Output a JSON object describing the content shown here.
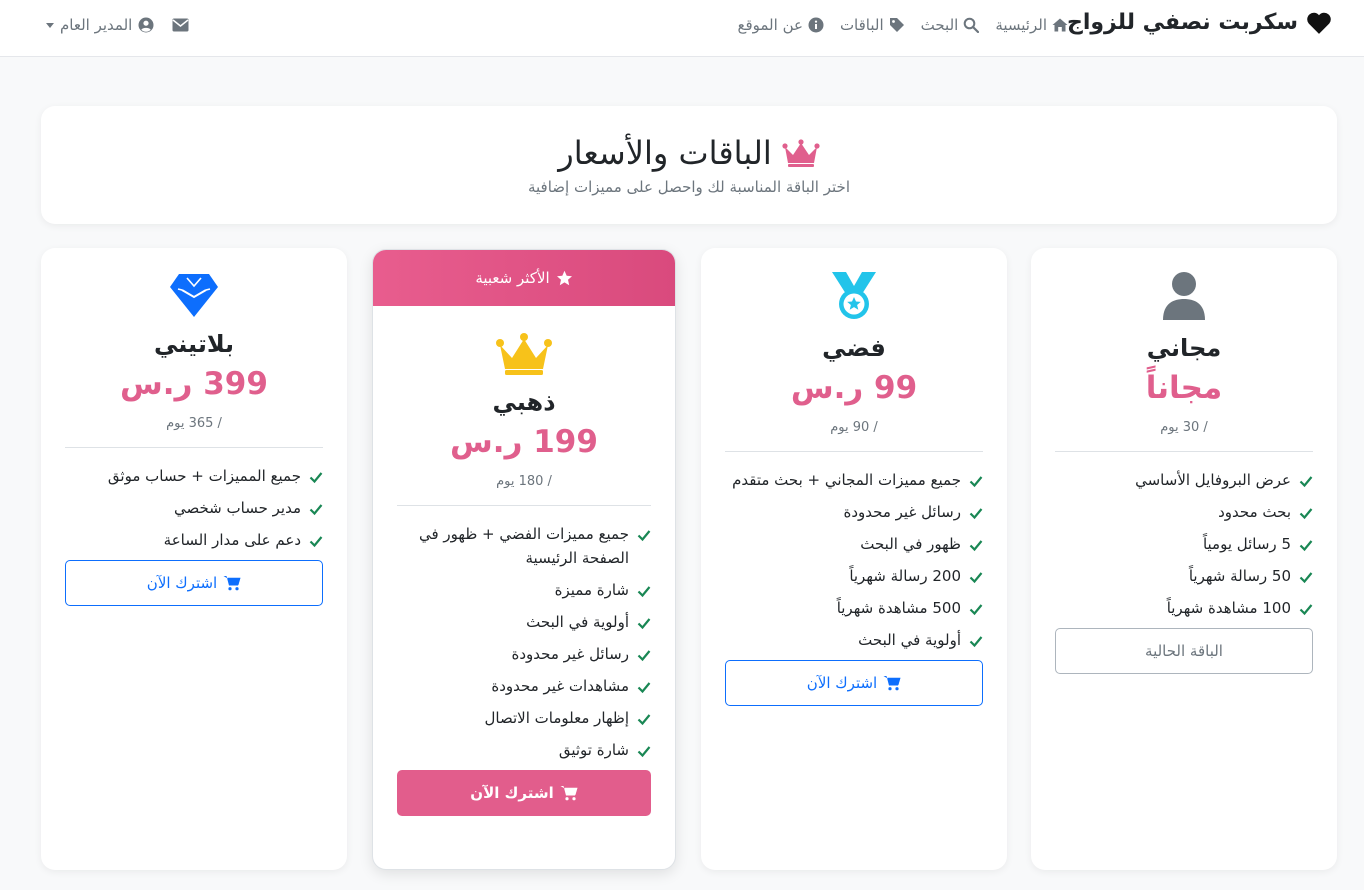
{
  "navbar": {
    "brand": "سكربت نصفي للزواج",
    "links": [
      "الرئيسية",
      "البحث",
      "الباقات",
      "عن الموقع"
    ],
    "admin_label": "المدير العام"
  },
  "header": {
    "title": "الباقات والأسعار",
    "subtitle": "اختر الباقة المناسبة لك واحصل على مميزات إضافية"
  },
  "plans": {
    "free": {
      "name": "مجاني",
      "price": "مجاناً",
      "duration": "/ 30 يوم",
      "features": [
        "عرض البروفايل الأساسي",
        "بحث محدود",
        "5 رسائل يومياً",
        "50 رسالة شهرياً",
        "100 مشاهدة شهرياً"
      ],
      "button": "الباقة الحالية"
    },
    "silver": {
      "name": "فضي",
      "price": "99 ر.س",
      "duration": "/ 90 يوم",
      "features": [
        "جميع مميزات المجاني + بحث متقدم",
        "رسائل غير محدودة",
        "ظهور في البحث",
        "200 رسالة شهرياً",
        "500 مشاهدة شهرياً",
        "أولوية في البحث"
      ],
      "button": "اشترك الآن"
    },
    "gold": {
      "badge": "الأكثر شعبية",
      "name": "ذهبي",
      "price": "199 ر.س",
      "duration": "/ 180 يوم",
      "features": [
        "جميع مميزات الفضي + ظهور في الصفحة الرئيسية",
        "شارة مميزة",
        "أولوية في البحث",
        "رسائل غير محدودة",
        "مشاهدات غير محدودة",
        "إظهار معلومات الاتصال",
        "شارة توثيق"
      ],
      "button": "اشترك الآن"
    },
    "platinum": {
      "name": "بلاتيني",
      "price": "399 ر.س",
      "duration": "/ 365 يوم",
      "features": [
        "جميع المميزات + حساب موثق",
        "مدير حساب شخصي",
        "دعم على مدار الساعة"
      ],
      "button": "اشترك الآن"
    }
  },
  "colors": {
    "primary_pink": "#e05f8d",
    "gold": "#f7c21a",
    "silver_medal": "#22c4ea",
    "platinum": "#0d6efd",
    "check_green": "#198754"
  },
  "icons": {
    "brand": "heart-icon",
    "nav": [
      "home-icon",
      "search-icon",
      "tag-icon",
      "info-icon"
    ],
    "admin": "user-circle-icon",
    "messages": "envelope-icon",
    "header": "crown-icon",
    "free": "user-icon",
    "silver": "medal-icon",
    "gold": "crown-icon",
    "platinum": "gem-icon"
  }
}
